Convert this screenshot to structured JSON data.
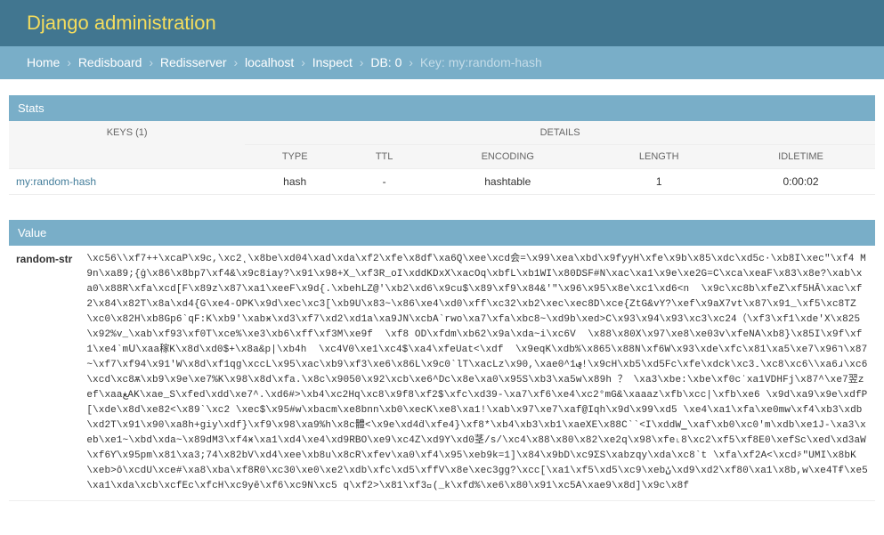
{
  "header": {
    "title": "Django administration"
  },
  "breadcrumbs": {
    "items": [
      {
        "label": "Home"
      },
      {
        "label": "Redisboard"
      },
      {
        "label": "Redisserver"
      },
      {
        "label": "localhost"
      },
      {
        "label": "Inspect"
      },
      {
        "label": "DB: 0"
      }
    ],
    "current": "Key: my:random-hash"
  },
  "stats": {
    "heading": "Stats",
    "keys_header": "KEYS (1)",
    "details_header": "DETAILS",
    "columns": {
      "type": "TYPE",
      "ttl": "TTL",
      "encoding": "ENCODING",
      "length": "LENGTH",
      "idletime": "IDLETIME"
    },
    "row": {
      "key": "my:random-hash",
      "type": "hash",
      "ttl": "-",
      "encoding": "hashtable",
      "length": "1",
      "idletime": "0:00:02"
    }
  },
  "value": {
    "heading": "Value",
    "field": "random-str",
    "content": "\\xc56\\\\xf7++\\xcaP\\x9c,\\xc2˛\\x8be\\xd04\\xad\\xda\\xf2\\xfe\\x8df\\xa6Q\\xee\\xcd会=\\x99\\xea\\xbd\\x9fyyH\\xfe\\x9b\\x85\\xdc\\xd5c·\\xb8I\\xec\"\\xf4 M9n\\xa89;{ġ\\x86\\x8bp7\\xf4&\\x9c8iay?\\x91\\x98+X_\\xf3R_oI\\xddKDxX\\xacOq\\xbfL\\xb1WI\\x80DSF#N\\xac\\xa1\\x9e\\xe2G=C\\xca\\xeaF\\x83\\x8e?\\xab\\xa0\\x88R\\xfa\\xcd[F\\x89z\\x87\\xa1\\xeeF\\x9d{.\\xbehLZ@'\\xb2\\xd6\\x9cu$\\x89\\xf9\\x84&'\"\\x96\\x95\\x8e\\xc1\\xd6<n  \\x9c\\xc8b\\xfeZ\\xf5HĀ\\xac\\xf2\\x84\\x82T\\x8a\\xd4{G\\xe4-OPK\\x9d\\xec\\xc3[\\xb9U\\x83~\\x86\\xe4\\xd0\\xff\\xc32\\xb2\\xec\\xec8D\\xce{ZtG&vY?\\xef\\x9aX7vt\\x87\\x91_\\xf5\\xc8TZ\\xc0\\x82H\\xb8Gp6`qF:K\\xb9'\\xabӿ\\xd3\\xf7\\xd2\\xd1a\\xa9JN\\xcbA`rwo\\xa7\\xfa\\xbc8~\\xd9b\\xed>C\\x93\\x94\\x93\\xc3\\xc24（\\xf3\\xf1\\xde'X\\x825\\x92%v_\\xab\\xf93\\xf0T\\xce%\\xe3\\xb6\\xff\\xf3M\\xe9f  \\xf8 OD\\xfdm\\xb62\\x9a\\xda~i\\xc6V  \\x88\\x80X\\x97\\xe8\\xe03v\\xfeNA\\xb8}\\x85I\\x9f\\xf1\\xe4`mՍ\\xaa稼K\\x8d\\xd0$+\\x8a&p|\\xb4h  \\xc4V0\\xe1\\xc4$\\xa4\\xfeUat<\\xdf  \\x9eqK\\xdb%\\x865\\x88N\\xf6W\\x93\\xde\\xfc\\x81\\xa5\\xe7\\x96ﬧ\\x87~\\xf7\\xf94\\x91'W\\x8d\\xf1qg\\xccL\\x95\\xac\\xb9\\xf3\\xe6\\x86L\\x9c0`lT\\xacLz\\x90,\\xae0^1ݠ!\\x9cH\\xb5\\xd5Fc\\xfe\\xdck\\xc3۔\\xc8\\xc6\\\\xa6ɹ\\xc6 \\xcd\\xc8ѫ\\xb9\\x9e\\xe7%K\\x98\\x8d\\xfa.\\x8c\\x9050\\x92\\xcb\\xe6^Dc\\x8e\\xa0\\x95S\\xb3\\xa5w\\x89h ？ \\xa3\\xbe:\\xbe\\xf0cʾxa1VDHFj\\x87^\\xe7翌zef\\xaaﻎAK\\xae_S\\xfed\\xdd\\xe7^.\\xd6#>\\xb4\\xc2Hq\\xc8\\x9f8\\xf2$\\xfc\\xd39-\\xa7\\xf6\\xe4\\xc2°mG&\\xaaaz\\xfb\\xcc|\\xfb\\xe6 \\x9d\\xa9\\x9e\\xdfP[\\xde\\x8d\\xe82<\\x89`\\xc2 \\xec$\\x95#w\\xbacm\\xe8bnn\\xb0\\xecK\\xe8\\xa1!\\xab\\x97\\xe7\\xaf@Iqh\\x9d\\x99\\xd5 \\xe4\\xa1\\xfa\\xe0mw\\xf4\\xb3\\xdb\\xd2T\\x91\\x90\\xa8h+giy\\xdf}\\xf9\\x98\\xa9%h\\x8c體<\\x9e\\xd4ḋ\\xfe4}\\xf8*\\xb4\\xb3\\xb1\\xaeXE\\x88C``<I\\xddW‗\\xaf\\xb0\\xc0'm\\xdb\\xe1J-\\xa3\\xeb\\xe1~\\xbd\\xda~\\x89dM3\\xf4ӿ\\xa1\\xd4\\xe4\\xd9RBO\\xe9\\xc4Z\\xd9Y\\xd0茎/s/\\xc4\\x88\\x80\\x82\\xe2q\\x98\\xfe˪8\\xc2\\xf5\\xf8E0\\xefSc\\xed\\xd3aW\\xf6Ƴ\\x95pm\\x81\\xa3;74\\x82bV\\xd4\\xee\\xb8u\\x8cR\\xfev\\xa0\\xf4\\x95\\xeb9k=1]\\x84\\x9bD\\xc9ΣS\\xabzqy\\xda\\xc8`t \\xfa\\xf2A<\\xcdᶳ\"UMI\\x8bK\\xeb>ô\\xcdU\\xce#\\xa8\\xba\\xf8R0\\xc30\\xe0\\xe2\\xdb\\xfc\\xd5\\xffV\\x8e\\xec3gg?\\xcc[\\xa1\\xf5\\xd5\\xc9\\xebݩ\\xd9\\xd2\\xf80\\xa1\\x8b,w\\xe4Tᵮ\\xe5\\xa1\\xda\\xcb\\xcfEc\\xfcH\\xc9yӗ\\xf6\\xc9N\\xc5 q\\xf2>\\x81\\xf3⃥(_k\\xfd%\\xe6\\x80\\x91\\xc5A\\xae9\\x8d]\\x9c\\x8f"
  }
}
